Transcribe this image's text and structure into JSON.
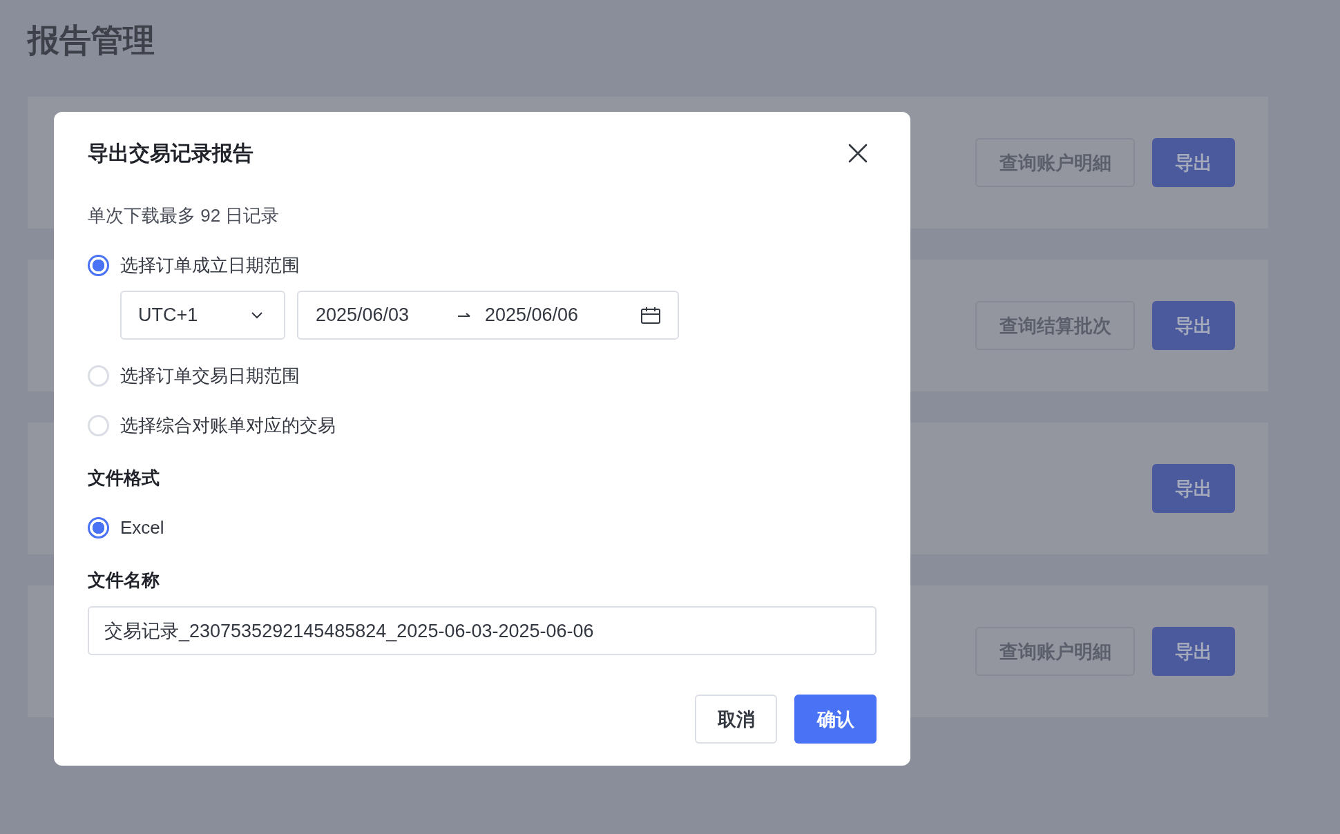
{
  "page": {
    "title": "报告管理"
  },
  "report_cards": [
    {
      "buttons": [
        {
          "label": "查询账户明細",
          "kind": "secondary"
        },
        {
          "label": "导出",
          "kind": "primary"
        }
      ]
    },
    {
      "buttons": [
        {
          "label": "查询结算批次",
          "kind": "secondary"
        },
        {
          "label": "导出",
          "kind": "primary"
        }
      ]
    },
    {
      "buttons": [
        {
          "label": "导出",
          "kind": "primary"
        }
      ]
    },
    {
      "buttons": [
        {
          "label": "查询账户明細",
          "kind": "secondary"
        },
        {
          "label": "导出",
          "kind": "primary"
        }
      ]
    }
  ],
  "dialog": {
    "title": "导出交易记录报告",
    "note": "单次下载最多 92 日记录",
    "range_options": [
      {
        "label": "选择订单成立日期范围",
        "selected": true
      },
      {
        "label": "选择订单交易日期范围",
        "selected": false
      },
      {
        "label": "选择综合对账单对应的交易",
        "selected": false
      }
    ],
    "timezone": {
      "value": "UTC+1"
    },
    "date_range": {
      "start": "2025/06/03",
      "end": "2025/06/06"
    },
    "file_format": {
      "label": "文件格式",
      "options": [
        {
          "label": "Excel",
          "selected": true
        }
      ]
    },
    "file_name": {
      "label": "文件名称",
      "value": "交易记录_2307535292145485824_2025-06-03-2025-06-06"
    },
    "buttons": [
      {
        "label": "取消",
        "kind": "secondary"
      },
      {
        "label": "确认",
        "kind": "primary"
      }
    ]
  }
}
